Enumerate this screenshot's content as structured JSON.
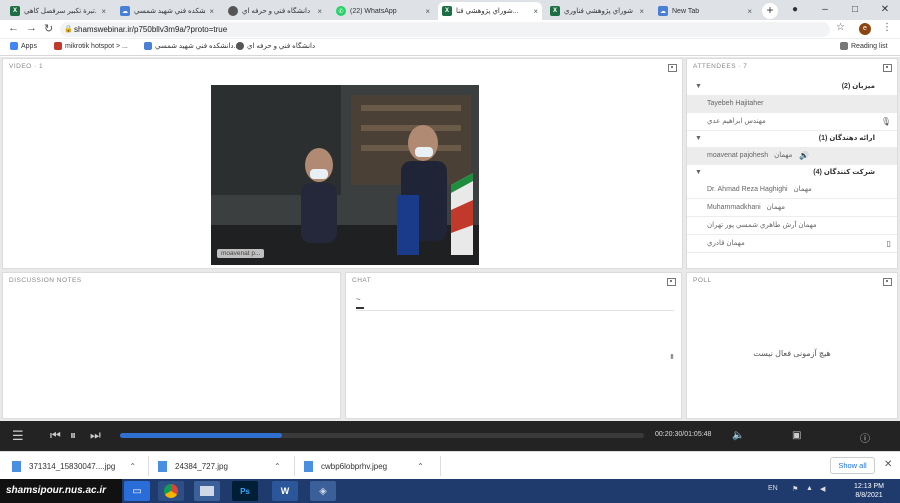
{
  "tabs": [
    {
      "title": "تبرة تكبير سرفصل كاهي...",
      "icon": "excel-icon",
      "active": false
    },
    {
      "title": "دانشكده فني شهيد شمسي ...",
      "icon": "cloud-icon",
      "active": false
    },
    {
      "title": "دانشگاه فني و حرفه اي",
      "icon": "chrome-icon",
      "active": false
    },
    {
      "title": "(22) WhatsApp",
      "icon": "whatsapp-icon",
      "active": false
    },
    {
      "title": "شوراي پژوهشي فنا...",
      "icon": "excel-icon",
      "active": true
    },
    {
      "title": "شوراي پژوهشي فناوري ...",
      "icon": "excel-icon",
      "active": false
    },
    {
      "title": "New Tab",
      "icon": "cloud-icon",
      "active": false
    }
  ],
  "address": {
    "url": "shamswebinar.ir/p750bllv3m9a/?proto=true"
  },
  "profile_initial": "e",
  "bookmarks": [
    {
      "label": "Apps"
    },
    {
      "label": "mikrotik hotspot > ..."
    },
    {
      "label": "دانشكده فني شهيد شمسي..."
    },
    {
      "label": "دانشگاه فني و حرفه اي"
    }
  ],
  "reading_list": "Reading list",
  "video": {
    "header": "VIDEO · 1",
    "name_tag": "moavenat p..."
  },
  "attendees": {
    "header": "ATTENDEES · 7",
    "groups": [
      {
        "label": "میزبان (2)",
        "items": [
          {
            "name": "Tayebeh Hajitaher",
            "selected": true,
            "icon": ""
          },
          {
            "name": "مهندس ابراهیم عدي",
            "selected": false,
            "icon": "mic-icon"
          }
        ]
      },
      {
        "label": "ارائه دهندگان (1)",
        "items": [
          {
            "name": "moavenat pajohesh",
            "badge": "مهمان",
            "selected": true,
            "icon": "speaker-icon"
          }
        ]
      },
      {
        "label": "شرکت کنندگان (4)",
        "items": [
          {
            "name": "Dr. Ahmad Reza Haghighi",
            "badge": "مهمان",
            "selected": false,
            "icon": ""
          },
          {
            "name": "Muhammadkhani",
            "badge": "مهمان",
            "selected": false,
            "icon": ""
          },
          {
            "name": "مهمان آرش طاهري شمسي پور تهران",
            "selected": false,
            "icon": ""
          },
          {
            "name": "مهمان    قادري",
            "selected": false,
            "icon": "phone-icon"
          }
        ]
      }
    ]
  },
  "notes": {
    "header": "DISCUSSION NOTES"
  },
  "chat": {
    "header": "CHAT",
    "first_message": "~"
  },
  "poll": {
    "header": "POLL",
    "empty_text": "هیچ آزمونی فعال نیست"
  },
  "player": {
    "time": "00:20:30/01:05:48",
    "progress": 0.31
  },
  "downloads": [
    {
      "name": "371314_15830047....jpg"
    },
    {
      "name": "24384_727.jpg"
    },
    {
      "name": "cwbp6lobprhv.jpeg"
    }
  ],
  "show_all": "Show all",
  "taskbar": {
    "brand": "shamsipour.nus.ac.ir",
    "lang": "EN",
    "time": "12:13 PM",
    "date": "8/8/2021"
  }
}
